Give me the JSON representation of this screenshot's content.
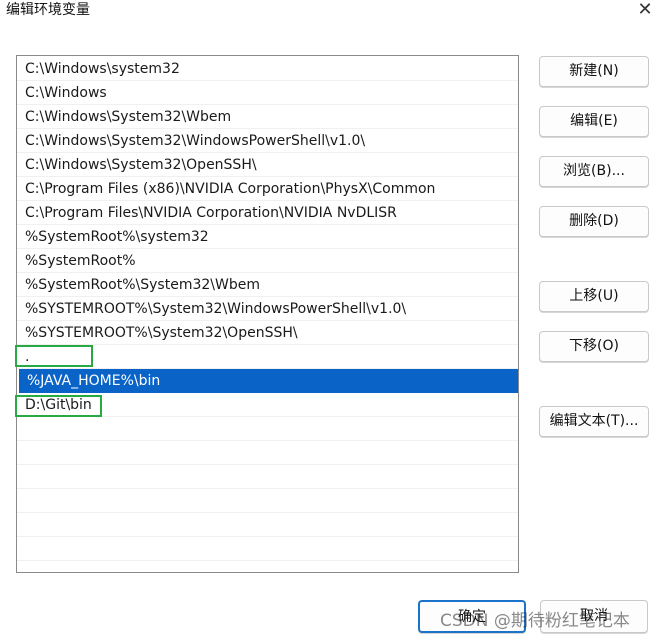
{
  "window": {
    "title": "编辑环境变量",
    "close_glyph": "✕"
  },
  "path_list": {
    "items": [
      {
        "value": "C:\\Windows\\system32",
        "selected": false
      },
      {
        "value": "C:\\Windows",
        "selected": false
      },
      {
        "value": "C:\\Windows\\System32\\Wbem",
        "selected": false
      },
      {
        "value": "C:\\Windows\\System32\\WindowsPowerShell\\v1.0\\",
        "selected": false
      },
      {
        "value": "C:\\Windows\\System32\\OpenSSH\\",
        "selected": false
      },
      {
        "value": "C:\\Program Files (x86)\\NVIDIA Corporation\\PhysX\\Common",
        "selected": false
      },
      {
        "value": "C:\\Program Files\\NVIDIA Corporation\\NVIDIA NvDLISR",
        "selected": false
      },
      {
        "value": "%SystemRoot%\\system32",
        "selected": false
      },
      {
        "value": "%SystemRoot%",
        "selected": false
      },
      {
        "value": "%SystemRoot%\\System32\\Wbem",
        "selected": false
      },
      {
        "value": "%SYSTEMROOT%\\System32\\WindowsPowerShell\\v1.0\\",
        "selected": false
      },
      {
        "value": "%SYSTEMROOT%\\System32\\OpenSSH\\",
        "selected": false
      },
      {
        "value": ".",
        "selected": false
      },
      {
        "value": "%JAVA_HOME%\\bin",
        "selected": true
      },
      {
        "value": "D:\\Git\\bin",
        "selected": false
      }
    ],
    "empty_rows": 7
  },
  "buttons": {
    "new": "新建(N)",
    "edit": "编辑(E)",
    "browse": "浏览(B)...",
    "delete": "删除(D)",
    "move_up": "上移(U)",
    "move_down": "下移(O)",
    "edit_text": "编辑文本(T)...",
    "ok": "确定",
    "cancel": "取消"
  },
  "watermark": "CSDN @期待粉红笔记本",
  "colors": {
    "selection": "#0a64c8",
    "annotation_box": "#27a943",
    "ok_border": "#1a73c8"
  }
}
